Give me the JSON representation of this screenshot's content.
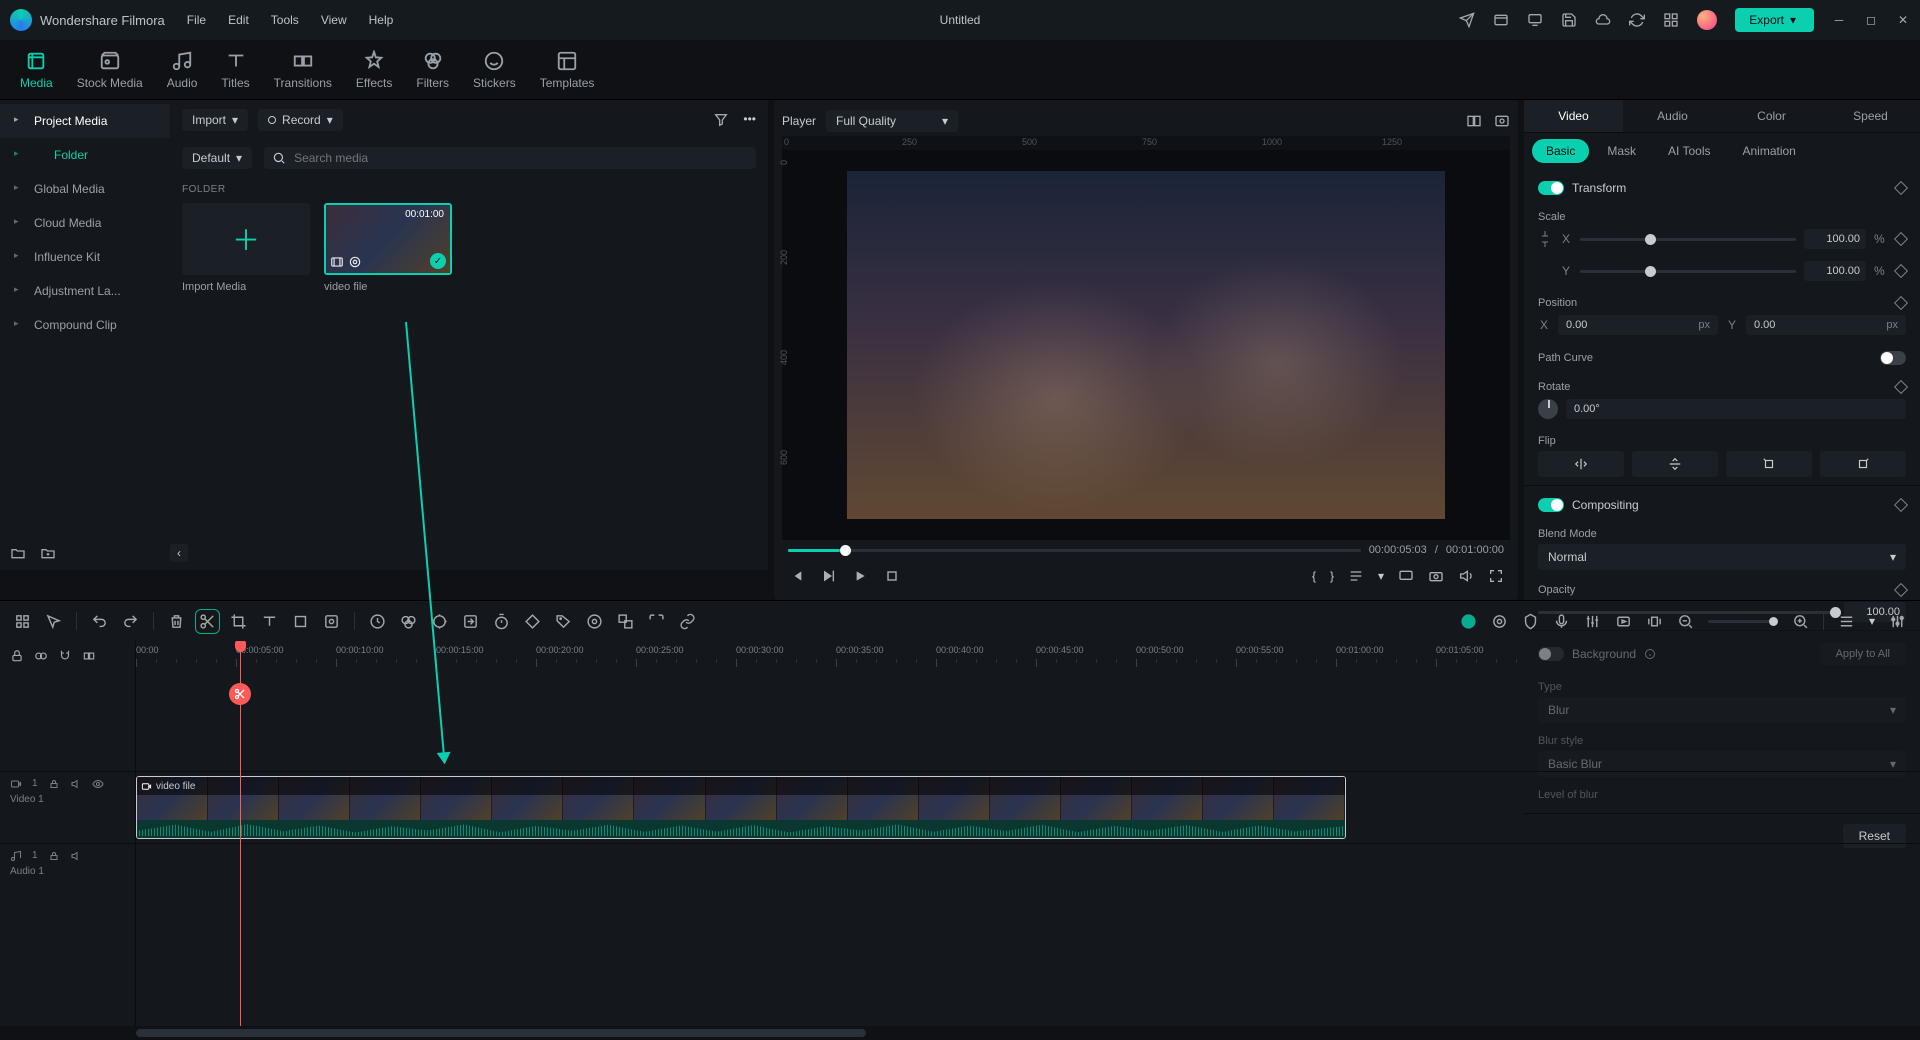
{
  "app": {
    "name": "Wondershare Filmora",
    "document": "Untitled"
  },
  "menu": [
    "File",
    "Edit",
    "Tools",
    "View",
    "Help"
  ],
  "export_label": "Export",
  "modules": [
    {
      "key": "media",
      "label": "Media"
    },
    {
      "key": "stock",
      "label": "Stock Media"
    },
    {
      "key": "audio",
      "label": "Audio"
    },
    {
      "key": "titles",
      "label": "Titles"
    },
    {
      "key": "transitions",
      "label": "Transitions"
    },
    {
      "key": "effects",
      "label": "Effects"
    },
    {
      "key": "filters",
      "label": "Filters"
    },
    {
      "key": "stickers",
      "label": "Stickers"
    },
    {
      "key": "templates",
      "label": "Templates"
    }
  ],
  "sidebar": {
    "items": [
      "Project Media",
      "Folder",
      "Global Media",
      "Cloud Media",
      "Influence Kit",
      "Adjustment La...",
      "Compound Clip"
    ]
  },
  "media": {
    "import_label": "Import",
    "record_label": "Record",
    "sort_label": "Default",
    "search_placeholder": "Search media",
    "folder_header": "FOLDER",
    "import_tile": "Import Media",
    "clip": {
      "name": "video file",
      "duration": "00:01:00"
    }
  },
  "player": {
    "label": "Player",
    "quality": "Full Quality",
    "ruler_marks": [
      "0",
      "250",
      "500",
      "750",
      "1000",
      "1250"
    ],
    "side_marks": [
      "0",
      "200",
      "400",
      "600"
    ],
    "time_current": "00:00:05:03",
    "time_total": "00:01:00:00",
    "time_sep": "/"
  },
  "inspector": {
    "tabs": [
      "Video",
      "Audio",
      "Color",
      "Speed"
    ],
    "subtabs": [
      "Basic",
      "Mask",
      "AI Tools",
      "Animation"
    ],
    "transform": {
      "title": "Transform",
      "scale_label": "Scale",
      "scale_x": "100.00",
      "scale_y": "100.00",
      "pct": "%",
      "position_label": "Position",
      "pos_x": "0.00",
      "pos_y": "0.00",
      "px": "px",
      "pathcurve_label": "Path Curve",
      "rotate_label": "Rotate",
      "rotate_val": "0.00°",
      "flip_label": "Flip"
    },
    "compositing": {
      "title": "Compositing",
      "blend_label": "Blend Mode",
      "blend_value": "Normal",
      "opacity_label": "Opacity",
      "opacity_value": "100.00"
    },
    "background": {
      "title": "Background",
      "type_label": "Type",
      "type_value": "Blur",
      "style_label": "Blur style",
      "style_value": "Basic Blur",
      "level_label": "Level of blur",
      "apply_all": "Apply to All"
    },
    "reset": "Reset"
  },
  "timeline": {
    "marks": [
      "00:00",
      "00:00:05:00",
      "00:00:10:00",
      "00:00:15:00",
      "00:00:20:00",
      "00:00:25:00",
      "00:00:30:00",
      "00:00:35:00",
      "00:00:40:00",
      "00:00:45:00",
      "00:00:50:00",
      "00:00:55:00",
      "00:01:00:00",
      "00:01:05:00"
    ],
    "tracks": {
      "video": "Video 1",
      "audio": "Audio 1"
    },
    "clip_label": "video file"
  }
}
